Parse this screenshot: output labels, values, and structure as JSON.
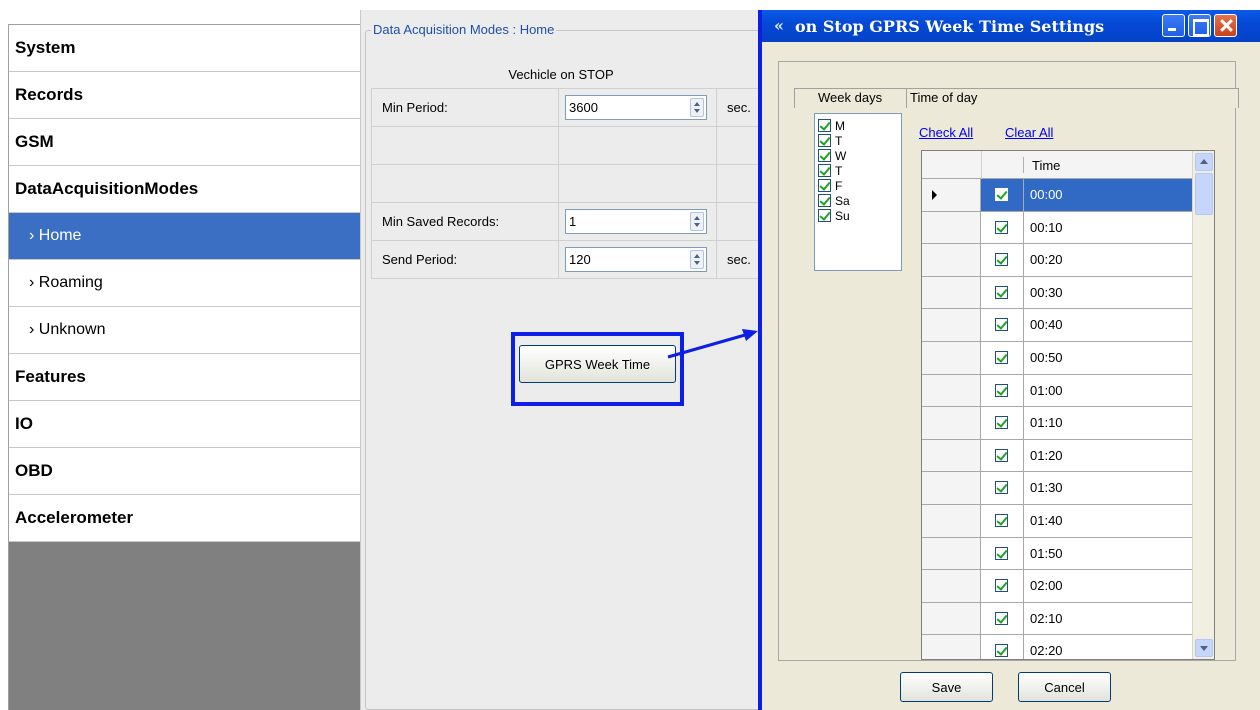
{
  "nav": {
    "items": [
      {
        "label": "System"
      },
      {
        "label": "Records"
      },
      {
        "label": "GSM"
      },
      {
        "label": "DataAcquisitionModes"
      },
      {
        "label": "› Home"
      },
      {
        "label": "› Roaming"
      },
      {
        "label": "› Unknown"
      },
      {
        "label": "Features"
      },
      {
        "label": "IO"
      },
      {
        "label": "OBD"
      },
      {
        "label": "Accelerometer"
      }
    ]
  },
  "main": {
    "group_title": "Data Acquisition Modes : Home",
    "mode_title": "Vechicle on STOP",
    "min_period_label": "Min Period:",
    "min_period_value": "3600",
    "min_period_unit": "sec.",
    "min_saved_label": "Min Saved Records:",
    "min_saved_value": "1",
    "send_period_label": "Send Period:",
    "send_period_value": "120",
    "send_period_unit": "sec.",
    "gprs_button": "GPRS Week Time"
  },
  "dialog": {
    "title": "on Stop GPRS Week Time Settings",
    "week_days_label": "Week days",
    "time_of_day_label": "Time of day",
    "week_days": [
      "M",
      "T",
      "W",
      "T",
      "F",
      "Sa",
      "Su"
    ],
    "check_all": "Check All",
    "clear_all": "Clear All",
    "time_header": "Time",
    "times": [
      "00:00",
      "00:10",
      "00:20",
      "00:30",
      "00:40",
      "00:50",
      "01:00",
      "01:10",
      "01:20",
      "01:30",
      "01:40",
      "01:50",
      "02:00",
      "02:10",
      "02:20"
    ],
    "save_label": "Save",
    "cancel_label": "Cancel"
  },
  "colors": {
    "highlight": "#0d1fe6",
    "selected": "#316ac5",
    "nav_selected": "#3b6fc4"
  }
}
